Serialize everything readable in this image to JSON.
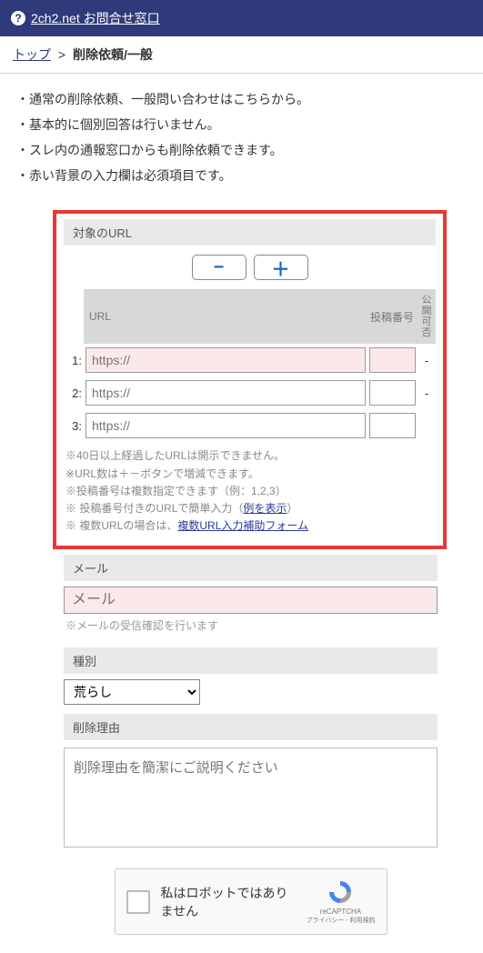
{
  "header": {
    "site_link": "2ch2.net お問合せ窓口"
  },
  "breadcrumb": {
    "top": "トップ",
    "sep": ">",
    "current": "削除依頼/一般"
  },
  "notes": [
    "通常の削除依頼、一般問い合わせはこちらから。",
    "基本的に個別回答は行いません。",
    "スレ内の通報窓口からも削除依頼できます。",
    "赤い背景の入力欄は必須項目です。"
  ],
  "url_section": {
    "label": "対象のURL",
    "headers": {
      "url": "URL",
      "postno": "投稿番号",
      "disclose": "公開可否"
    },
    "rows": [
      {
        "idx": "1:",
        "placeholder": "https://",
        "required": true,
        "disclose": "-"
      },
      {
        "idx": "2:",
        "placeholder": "https://",
        "required": false,
        "disclose": "-"
      },
      {
        "idx": "3:",
        "placeholder": "https://",
        "required": false,
        "disclose": ""
      }
    ],
    "hints": [
      "40日以上経過したURLは開示できません。",
      "URL数は＋－ボタンで増減できます。",
      "投稿番号は複数指定できます（例：1,2,3）"
    ],
    "hint_link1_prefix": "投稿番号付きのURLで簡単入力（",
    "hint_link1": "例を表示",
    "hint_link1_suffix": "）",
    "hint_link2_prefix": "複数URLの場合は、",
    "hint_link2": "複数URL入力補助フォーム"
  },
  "mail": {
    "label": "メール",
    "placeholder": "メール",
    "note": "メールの受信確認を行います"
  },
  "type": {
    "label": "種別",
    "selected": "荒らし"
  },
  "reason": {
    "label": "削除理由",
    "placeholder": "削除理由を簡潔にご説明ください"
  },
  "recaptcha": {
    "text": "私はロボットではありません",
    "brand": "reCAPTCHA",
    "terms": "プライバシー - 利用規約"
  }
}
